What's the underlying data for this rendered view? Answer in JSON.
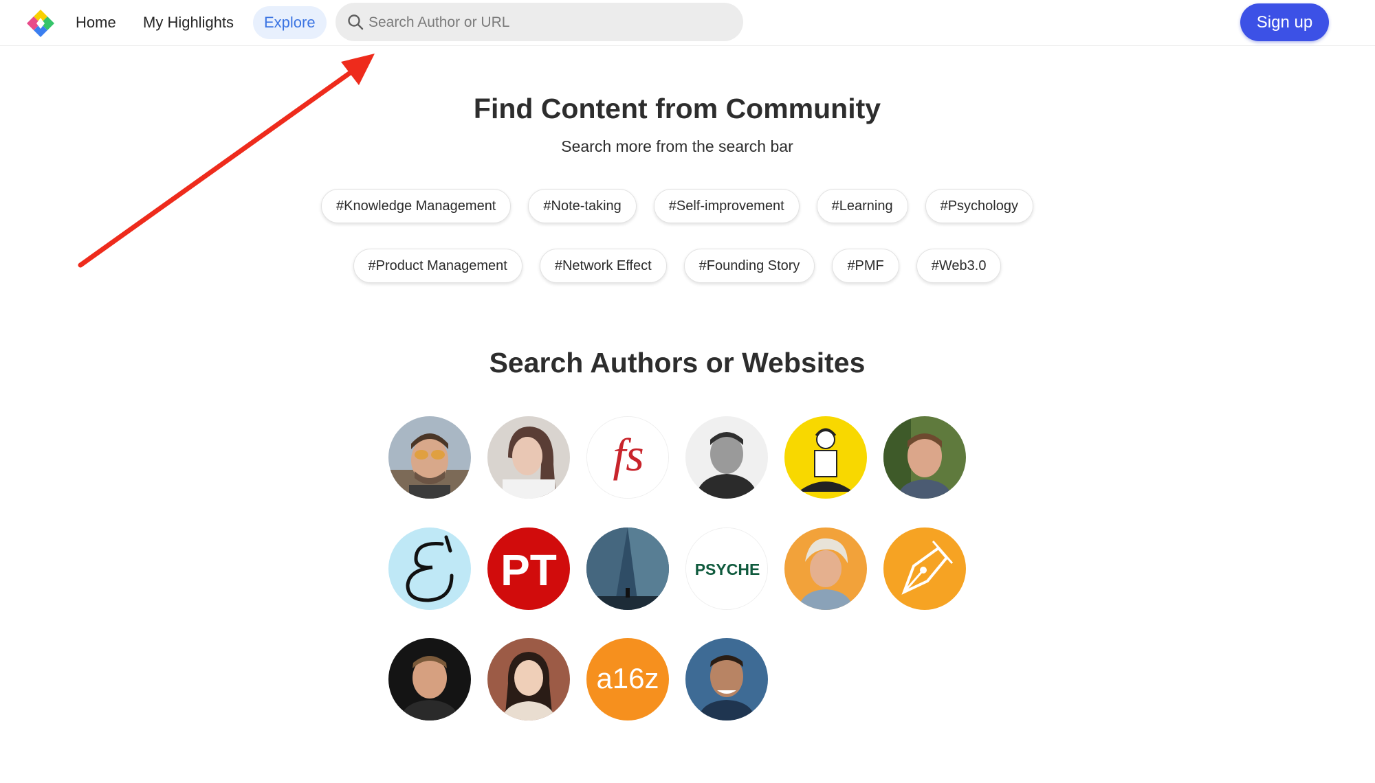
{
  "header": {
    "nav": {
      "home": "Home",
      "highlights": "My Highlights",
      "explore": "Explore"
    },
    "search_placeholder": "Search Author or URL",
    "signup": "Sign up",
    "accent_color": "#3c51e6",
    "explore_color": "#3b74e2"
  },
  "community": {
    "title": "Find Content from Community",
    "subtitle": "Search more from the search bar",
    "tags_row1": [
      "#Knowledge Management",
      "#Note-taking",
      "#Self-improvement",
      "#Learning",
      "#Psychology"
    ],
    "tags_row2": [
      "#Product Management",
      "#Network Effect",
      "#Founding Story",
      "#PMF",
      "#Web3.0"
    ]
  },
  "authors": {
    "title": "Search Authors or Websites",
    "logos": {
      "fs": "fs",
      "pt": "PT",
      "psyche": "PSYCHE",
      "a16z": "a16z"
    }
  },
  "annotation": {
    "arrow_color": "#ee2b1c"
  }
}
